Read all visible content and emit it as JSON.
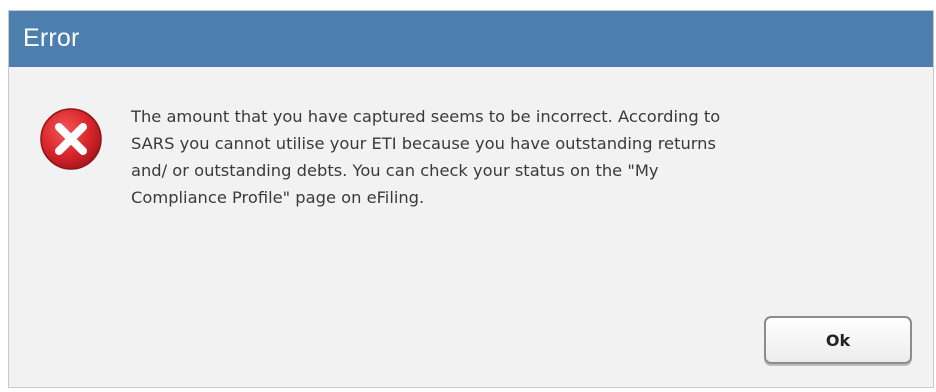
{
  "dialog": {
    "title": "Error",
    "icon": "error-icon",
    "message": "The amount that you have captured seems to be incorrect. According to\nSARS you cannot utilise your ETI because you have outstanding returns\nand/ or outstanding debts. You can check your status on the \"My\nCompliance Profile\" page on eFiling.",
    "ok_label": "Ok"
  },
  "colors": {
    "titlebar": "#4d7fae",
    "icon_red": "#d9252a",
    "body_bg": "#f2f2f2"
  }
}
